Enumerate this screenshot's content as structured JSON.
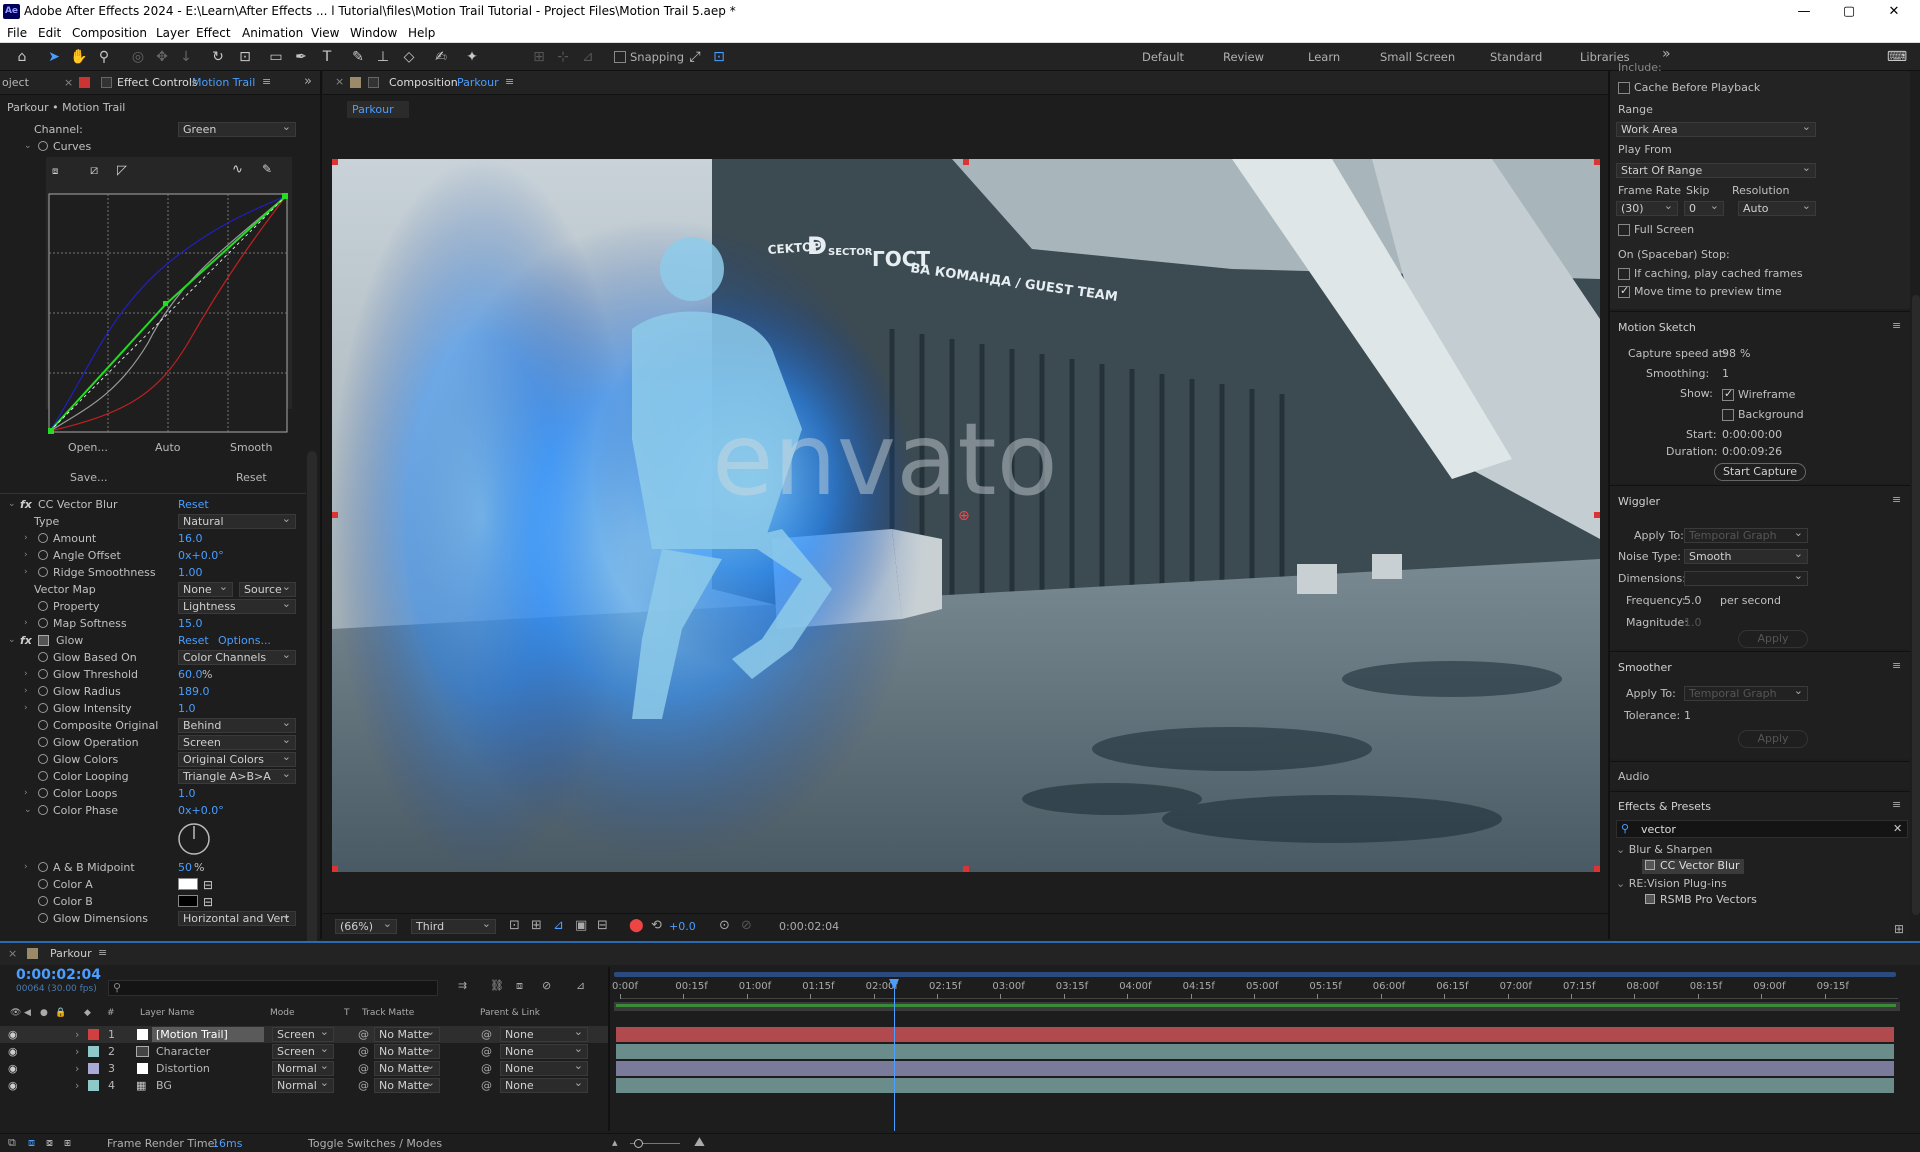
{
  "window": {
    "title": "Adobe After Effects 2024 - E:\\Learn\\After Effects ... l Tutorial\\files\\Motion Trail Tutorial - Project Files\\Motion Trail 5.aep *",
    "logo": "Ae",
    "minimize": "—",
    "maximize": "▢",
    "close": "✕"
  },
  "menu": [
    "File",
    "Edit",
    "Composition",
    "Layer",
    "Effect",
    "Animation",
    "View",
    "Window",
    "Help"
  ],
  "toolbar": {
    "snapping_label": "Snapping",
    "workspaces": [
      "Default",
      "Review",
      "Learn",
      "Small Screen",
      "Standard",
      "Libraries"
    ],
    "more": "»"
  },
  "effect_controls": {
    "tab_left": "oject",
    "tab_label": "Effect Controls",
    "tab_layer": "Motion Trail",
    "breadcrumb": "Parkour • Motion Trail",
    "channel_label": "Channel:",
    "channel_value": "Green",
    "curves_label": "Curves",
    "curves_buttons": [
      "Open...",
      "Auto",
      "Smooth",
      "Save...",
      "Reset"
    ],
    "cc_vector_blur": {
      "name": "CC Vector Blur",
      "reset": "Reset",
      "props": [
        {
          "label": "Type",
          "value": "Natural",
          "kind": "dd"
        },
        {
          "label": "Amount",
          "value": "16.0",
          "kind": "num"
        },
        {
          "label": "Angle Offset",
          "value": "0x+0.0°",
          "kind": "num"
        },
        {
          "label": "Ridge Smoothness",
          "value": "1.00",
          "kind": "num"
        },
        {
          "label": "Vector Map",
          "value": "None",
          "value2": "Source",
          "kind": "dd2"
        },
        {
          "label": "Property",
          "value": "Lightness",
          "kind": "dd"
        },
        {
          "label": "Map Softness",
          "value": "15.0",
          "kind": "num"
        }
      ]
    },
    "glow": {
      "name": "Glow",
      "reset": "Reset",
      "options": "Options...",
      "props": [
        {
          "label": "Glow Based On",
          "value": "Color Channels",
          "kind": "dd"
        },
        {
          "label": "Glow Threshold",
          "value": "60.0",
          "unit": "%",
          "kind": "num"
        },
        {
          "label": "Glow Radius",
          "value": "189.0",
          "kind": "num"
        },
        {
          "label": "Glow Intensity",
          "value": "1.0",
          "kind": "num"
        },
        {
          "label": "Composite Original",
          "value": "Behind",
          "kind": "dd"
        },
        {
          "label": "Glow Operation",
          "value": "Screen",
          "kind": "dd"
        },
        {
          "label": "Glow Colors",
          "value": "Original Colors",
          "kind": "dd"
        },
        {
          "label": "Color Looping",
          "value": "Triangle A>B>A",
          "kind": "dd"
        },
        {
          "label": "Color Loops",
          "value": "1.0",
          "kind": "num"
        },
        {
          "label": "Color Phase",
          "value": "0x+0.0°",
          "kind": "num"
        }
      ],
      "props2": [
        {
          "label": "A & B Midpoint",
          "value": "50",
          "unit": "%",
          "kind": "num"
        },
        {
          "label": "Color A",
          "kind": "color",
          "color": "#ffffff"
        },
        {
          "label": "Color B",
          "kind": "color",
          "color": "#000000"
        },
        {
          "label": "Glow Dimensions",
          "value": "Horizontal and Vert",
          "kind": "dd"
        }
      ]
    }
  },
  "composition": {
    "tab_label": "Composition",
    "tab_name": "Parkour",
    "flow_tab": "Parkour",
    "watermark": "envato",
    "signs": [
      "CEKTOP",
      "D",
      "SECTOR",
      "ГОСТ",
      "ВА КОМАНДА / GUEST TEAM"
    ],
    "footer": {
      "zoom": "(66%)",
      "resolution": "Third",
      "exposure": "+0.0",
      "timecode": "0:00:02:04"
    }
  },
  "right_panel": {
    "preview": {
      "include": "Include:",
      "cache_before_playback": "Cache Before Playback",
      "range_label": "Range",
      "range_value": "Work Area",
      "play_from_label": "Play From",
      "play_from_value": "Start Of Range",
      "frame_rate_label": "Frame Rate",
      "skip_label": "Skip",
      "resolution_label": "Resolution",
      "frame_rate_value": "(30)",
      "skip_value": "0",
      "resolution_value": "Auto",
      "full_screen": "Full Screen",
      "on_stop": "On (Spacebar) Stop:",
      "if_caching": "If caching, play cached frames",
      "move_time": "Move time to preview time"
    },
    "motion_sketch": {
      "title": "Motion Sketch",
      "capture_label": "Capture speed at:",
      "capture_value": "98",
      "capture_unit": "%",
      "smoothing_label": "Smoothing:",
      "smoothing_value": "1",
      "show_label": "Show:",
      "wireframe": "Wireframe",
      "background": "Background",
      "start_label": "Start:",
      "start_value": "0:00:00:00",
      "duration_label": "Duration:",
      "duration_value": "0:00:09:26",
      "start_capture": "Start Capture"
    },
    "wiggler": {
      "title": "Wiggler",
      "apply_to_label": "Apply To:",
      "apply_to_value": "Temporal Graph",
      "noise_label": "Noise Type:",
      "noise_value": "Smooth",
      "dimensions_label": "Dimensions:",
      "frequency_label": "Frequency:",
      "frequency_value": "5.0",
      "frequency_unit": "per second",
      "magnitude_label": "Magnitude:",
      "magnitude_value": "1.0",
      "apply": "Apply"
    },
    "smoother": {
      "title": "Smoother",
      "apply_to_label": "Apply To:",
      "apply_to_value": "Temporal Graph",
      "tolerance_label": "Tolerance:",
      "tolerance_value": "1",
      "apply": "Apply"
    },
    "audio": {
      "title": "Audio"
    },
    "effects_presets": {
      "title": "Effects & Presets",
      "search_value": "vector",
      "groups": [
        {
          "name": "Blur & Sharpen",
          "items": [
            "CC Vector Blur"
          ]
        },
        {
          "name": "RE:Vision Plug-ins",
          "items": [
            "RSMB Pro Vectors"
          ]
        }
      ]
    }
  },
  "timeline": {
    "tab_name": "Parkour",
    "timecode": "0:00:02:04",
    "frames_info": "00064 (30.00 fps)",
    "col_headers": {
      "num": "#",
      "layer_name": "Layer Name",
      "mode": "Mode",
      "t": "T",
      "track_matte": "Track Matte",
      "parent": "Parent & Link"
    },
    "layers": [
      {
        "num": "1",
        "name": "[Motion Trail]",
        "mode": "Screen",
        "matte": "No Matte",
        "parent": "None",
        "label": "#d04040",
        "bar": "#b04a4e"
      },
      {
        "num": "2",
        "name": "Character",
        "mode": "Screen",
        "matte": "No Matte",
        "parent": "None",
        "label": "#8fc8c8",
        "bar": "#6a8c8a"
      },
      {
        "num": "3",
        "name": "Distortion",
        "mode": "Normal",
        "matte": "No Matte",
        "parent": "None",
        "label": "#a9a9d8",
        "bar": "#7a7a9a"
      },
      {
        "num": "4",
        "name": "BG",
        "mode": "Normal",
        "matte": "No Matte",
        "parent": "None",
        "label": "#8fc8c8",
        "bar": "#6a8c8a"
      }
    ],
    "ruler": [
      "0:00f",
      "00:15f",
      "01:00f",
      "01:15f",
      "02:00f",
      "02:15f",
      "03:00f",
      "03:15f",
      "04:00f",
      "04:15f",
      "05:00f",
      "05:15f",
      "06:00f",
      "06:15f",
      "07:00f",
      "07:15f",
      "08:00f",
      "08:15f",
      "09:00f",
      "09:15f"
    ],
    "playhead_fraction": 0.2161,
    "footer": {
      "render_label": "Frame Render Time:",
      "render_value": "16ms",
      "toggle": "Toggle Switches / Modes"
    }
  },
  "colors": {
    "accent": "#4a9eff",
    "panel": "#1d1d1d",
    "header": "#232323"
  }
}
